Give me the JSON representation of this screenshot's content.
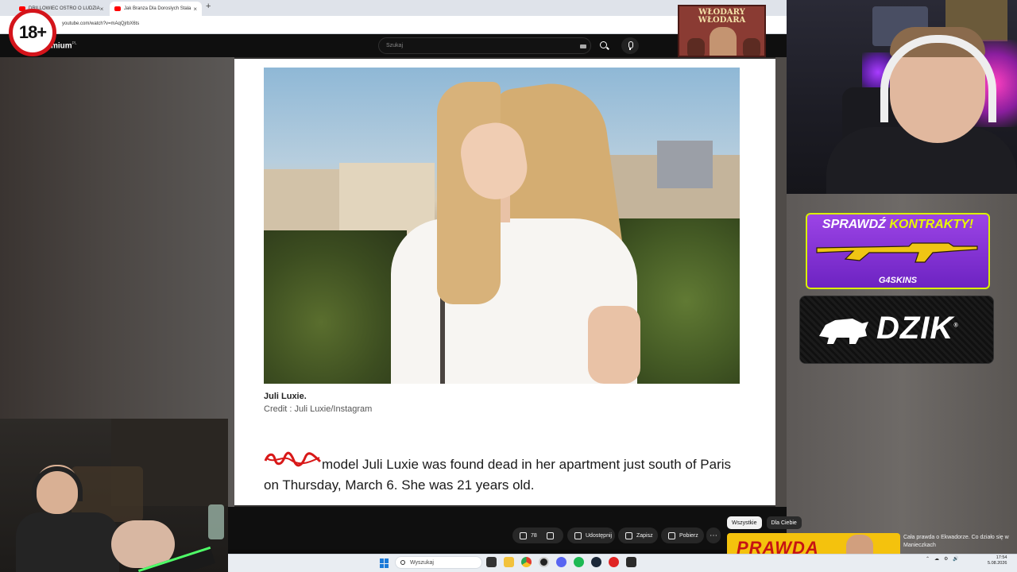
{
  "browser": {
    "tabs": [
      {
        "label": "DRILLOWIEC OSTRO O LUDZIA",
        "active": false
      },
      {
        "label": "Jak Branza Dla Doroslych Stala",
        "active": true
      }
    ],
    "new_tab_label": "+",
    "url": "youtube.com/watch?v=mAqQjrbX6ts"
  },
  "badges": {
    "age": "18+"
  },
  "youtube": {
    "logo": "mium",
    "logo_region": "PL",
    "search_placeholder": "Szukaj"
  },
  "poster": {
    "line1": "WŁODARY",
    "line2": "WŁODARA"
  },
  "article": {
    "caption_name": "Juli Luxie.",
    "caption_credit": "Credit : Juli Luxie/Instagram",
    "body": "model Juli Luxie was found dead in her apartment just south of Paris on Thursday, March 6. She was 21 years old."
  },
  "actions": {
    "like_count": "78",
    "share": "Udostępnij",
    "save": "Zapisz",
    "download": "Pobierz",
    "more": "⋯"
  },
  "recommend": {
    "chips": [
      {
        "label": "Wszystkie",
        "active": true
      },
      {
        "label": "Dla Ciebie",
        "active": false
      }
    ],
    "thumb_text": "PRAWDA",
    "title": "Cała prawda o Ekwadorze. Co działo się w Manieczkach"
  },
  "sponsors": {
    "s1_title_a": "SPRAWDŹ",
    "s1_title_b": "KONTRAKTY!",
    "s1_brand": "G4SKINS",
    "s2_brand": "DZIK",
    "s2_mark": "®"
  },
  "taskbar": {
    "search_placeholder": "Wyszukaj",
    "time": "17:54",
    "date": "5.08.2026"
  },
  "colors": {
    "youtube_red": "#ff0000",
    "badge_red": "#d4141b",
    "sponsor_purple": "#7a2fd0",
    "sponsor_yellow": "#e8f800",
    "scribble_red": "#d81818"
  }
}
